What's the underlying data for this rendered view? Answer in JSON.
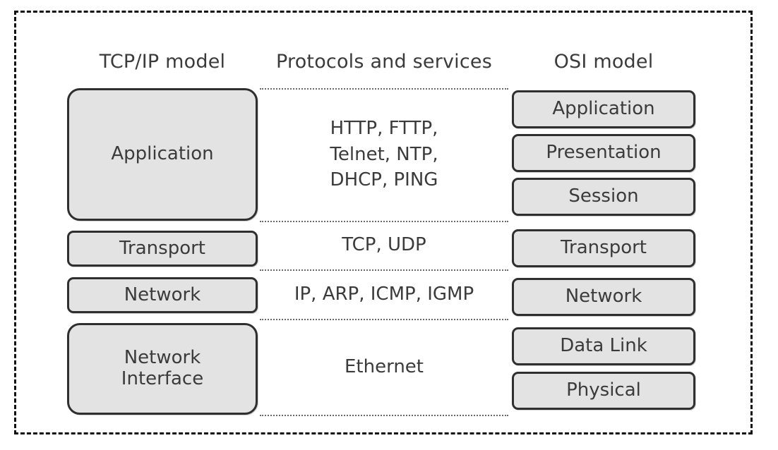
{
  "diagram": {
    "title": "TCP/IP model versus OSI model with protocols and services",
    "colors": {
      "box_fill": "#e3e3e3",
      "box_border": "#2f2f2f",
      "text": "#3b3b3b",
      "frame_border": "#111111",
      "separator": "#6a6a6a",
      "background": "#ffffff"
    },
    "headers": {
      "left": "TCP/IP model",
      "middle": "Protocols and services",
      "right": "OSI model"
    },
    "tcpip_layers": [
      {
        "label": "Application"
      },
      {
        "label": "Transport"
      },
      {
        "label": "Network"
      },
      {
        "label": "Network\nInterface"
      }
    ],
    "protocols": [
      {
        "label": "HTTP, FTTP,\nTelnet, NTP,\nDHCP, PING"
      },
      {
        "label": "TCP, UDP"
      },
      {
        "label": "IP, ARP, ICMP, IGMP"
      },
      {
        "label": "Ethernet"
      }
    ],
    "osi_layers": [
      {
        "label": "Application"
      },
      {
        "label": "Presentation"
      },
      {
        "label": "Session"
      },
      {
        "label": "Transport"
      },
      {
        "label": "Network"
      },
      {
        "label": "Data Link"
      },
      {
        "label": "Physical"
      }
    ],
    "separators": [
      125,
      313,
      382,
      452,
      588
    ]
  }
}
